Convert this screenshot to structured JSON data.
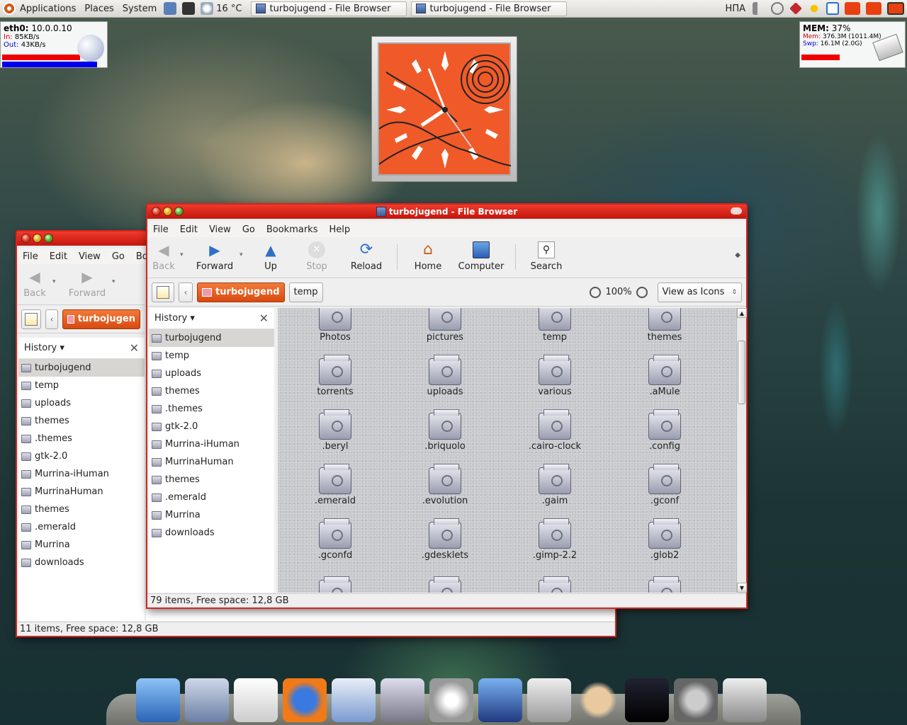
{
  "topbar": {
    "menus": [
      "Applications",
      "Places",
      "System"
    ],
    "weather": "16 °C",
    "tasks": [
      "turbojugend - File Browser",
      "turbojugend - File Browser"
    ],
    "keyboard": "НПА"
  },
  "net_widget": {
    "iface": "eth0:",
    "ip": "10.0.0.10",
    "in_label": "In:",
    "in_value": "85KB/s",
    "out_label": "Out:",
    "out_value": "43KB/s"
  },
  "mem_widget": {
    "label": "MEM:",
    "pct": "37%",
    "mem_label": "Mem:",
    "mem_value": "376.3M (1011.4M)",
    "swp_label": "Swp:",
    "swp_value": "16.1M (2.0G)"
  },
  "back_window": {
    "menu": [
      "File",
      "Edit",
      "View",
      "Go",
      "Boo"
    ],
    "toolbar": {
      "back": "Back",
      "forward": "Forward"
    },
    "crumb": "turbojugen",
    "history_label": "History",
    "history": [
      "turbojugend",
      "temp",
      "uploads",
      "themes",
      ".themes",
      "gtk-2.0",
      "Murrina-iHuman",
      "MurrinaHuman",
      "themes",
      ".emerald",
      "Murrina",
      "downloads"
    ],
    "status": "11 items, Free space: 12,8 GB"
  },
  "front_window": {
    "title": "turbojugend - File Browser",
    "menu": [
      "File",
      "Edit",
      "View",
      "Go",
      "Bookmarks",
      "Help"
    ],
    "toolbar": {
      "back": "Back",
      "forward": "Forward",
      "up": "Up",
      "stop": "Stop",
      "reload": "Reload",
      "home": "Home",
      "computer": "Computer",
      "search": "Search"
    },
    "crumbs": [
      "turbojugend",
      "temp"
    ],
    "zoom": "100%",
    "view_mode": "View as Icons",
    "history_label": "History",
    "history": [
      "turbojugend",
      "temp",
      "uploads",
      "themes",
      ".themes",
      "gtk-2.0",
      "Murrina-iHuman",
      "MurrinaHuman",
      "themes",
      ".emerald",
      "Murrina",
      "downloads"
    ],
    "files": [
      "Photos",
      "pictures",
      "temp",
      "themes",
      "torrents",
      "uploads",
      "various",
      ".aMule",
      ".beryl",
      ".briquolo",
      ".cairo-clock",
      ".config",
      ".emerald",
      ".evolution",
      ".gaim",
      ".gconf",
      ".gconfd",
      ".gdesklets",
      ".gimp-2.2",
      ".glob2"
    ],
    "status": "79 items, Free space: 12,8 GB"
  },
  "colors": {
    "accent": "#d8241c",
    "crumb_active": "#e05a1c",
    "clock_face": "#f05a28"
  },
  "dock_icons": [
    "computer-icon",
    "file-manager-icon",
    "text-editor-icon",
    "firefox-icon",
    "mail-icon",
    "photo-icon",
    "music-icon",
    "video-icon",
    "package-icon",
    "amule-icon",
    "terminal-icon",
    "settings-icon",
    "trash-icon"
  ]
}
